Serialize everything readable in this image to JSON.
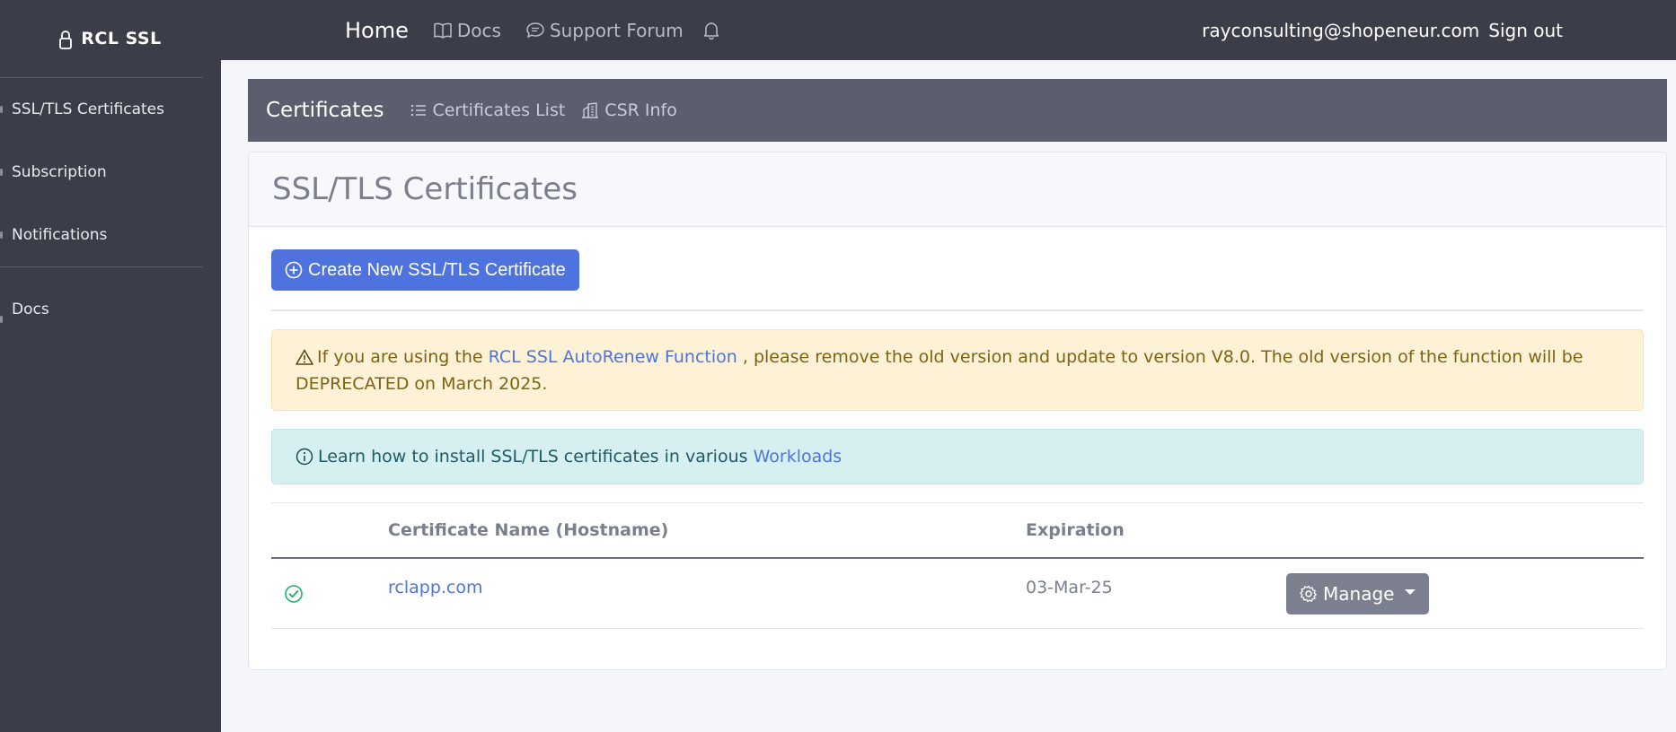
{
  "sidebar": {
    "brand": "RCL SSL",
    "items": [
      {
        "label": "SSL/TLS Certificates"
      },
      {
        "label": "Subscription"
      },
      {
        "label": "Notifications"
      },
      {
        "label": "Docs"
      }
    ]
  },
  "topnav": {
    "home": "Home",
    "docs": "Docs",
    "support": "Support Forum",
    "email": "rayconsulting@shopeneur.com",
    "signout": "Sign out"
  },
  "subheader": {
    "title": "Certificates",
    "links": [
      "Certificates List",
      "CSR Info"
    ]
  },
  "card": {
    "title": "SSL/TLS Certificates",
    "create_button": "Create New SSL/TLS Certificate",
    "warning": {
      "prefix": "If you are using the",
      "link": "RCL SSL AutoRenew Function",
      "suffix": ", please remove the old version and update to version V8.0. The old version of the function will be DEPRECATED on March 2025."
    },
    "info": {
      "prefix": "Learn how to install SSL/TLS certificates in various",
      "link": "Workloads"
    },
    "table": {
      "headers": [
        "Certificate Name (Hostname)",
        "Expiration"
      ],
      "rows": [
        {
          "name": "rclapp.com",
          "expiration": "03-Mar-25",
          "action": "Manage"
        }
      ]
    }
  },
  "colors": {
    "sidebar_bg": "#3b3d49",
    "subheader_bg": "#5b5e6d",
    "primary": "#4f73de",
    "success": "#20b26b",
    "manage_button": "#7c7f8d"
  }
}
